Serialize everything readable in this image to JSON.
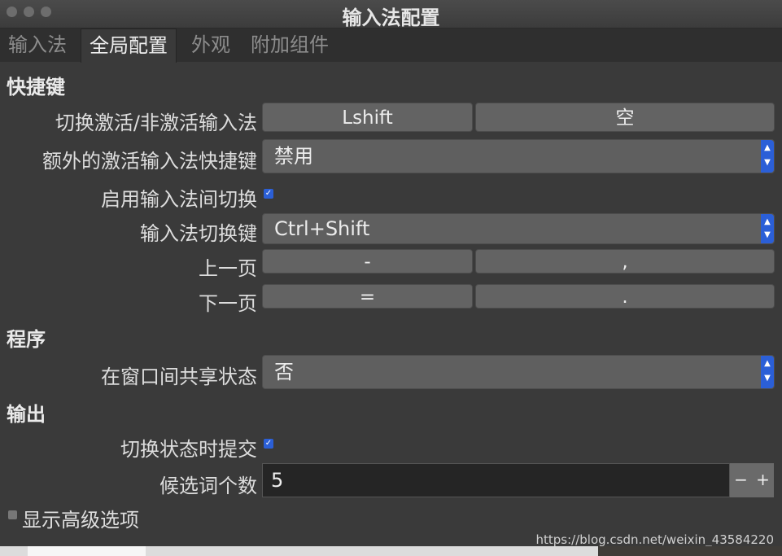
{
  "window": {
    "title": "输入法配置"
  },
  "tabs": [
    "输入法",
    "全局配置",
    "外观",
    "附加组件"
  ],
  "sections": {
    "shortcuts": "快捷键",
    "program": "程序",
    "output": "输出"
  },
  "rows": {
    "toggle": {
      "label": "切换激活/非激活输入法",
      "key1": "Lshift",
      "key2": "空"
    },
    "extra": {
      "label": "额外的激活输入法快捷键",
      "value": "禁用"
    },
    "enable_switch": {
      "label": "启用输入法间切换",
      "checked": true
    },
    "switch_key": {
      "label": "输入法切换键",
      "value": "Ctrl+Shift"
    },
    "prev_page": {
      "label": "上一页",
      "key1": "-",
      "key2": ","
    },
    "next_page": {
      "label": "下一页",
      "key1": "=",
      "key2": "."
    },
    "share_state": {
      "label": "在窗口间共享状态",
      "value": "否"
    },
    "commit_on_switch": {
      "label": "切换状态时提交",
      "checked": true
    },
    "candidates": {
      "label": "候选词个数",
      "value": "5",
      "minus": "−",
      "plus": "+"
    }
  },
  "advanced": {
    "label": "显示高级选项",
    "checked": false
  },
  "watermark": "https://blog.csdn.net/weixin_43584220",
  "colors": {
    "accent": "#2b5fd7",
    "window_bg": "#3a3a3a",
    "button_bg": "#636363"
  }
}
